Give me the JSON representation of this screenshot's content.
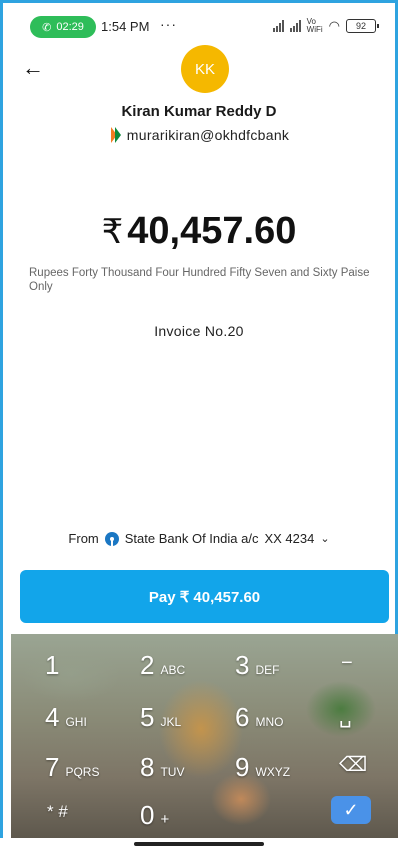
{
  "status_bar": {
    "call_time": "02:29",
    "time": "1:54 PM",
    "dots": "···",
    "battery": "92"
  },
  "payee": {
    "initials": "KK",
    "name": "Kiran Kumar Reddy D",
    "upi_id": "murarikiran@okhdfcbank"
  },
  "amount": {
    "currency_symbol": "₹",
    "value": "40,457.60",
    "in_words": "Rupees Forty Thousand Four Hundred Fifty Seven and Sixty Paise Only"
  },
  "note": "Invoice No.20",
  "from_account": {
    "label": "From",
    "bank": "State Bank Of India a/c",
    "account": "XX 4234"
  },
  "pay_button_label": "Pay ₹ 40,457.60",
  "keypad": {
    "keys": [
      {
        "digit": "1",
        "letters": ""
      },
      {
        "digit": "2",
        "letters": "ABC"
      },
      {
        "digit": "3",
        "letters": "DEF"
      },
      {
        "digit": "−",
        "letters": ""
      },
      {
        "digit": "4",
        "letters": "GHI"
      },
      {
        "digit": "5",
        "letters": "JKL"
      },
      {
        "digit": "6",
        "letters": "MNO"
      },
      {
        "digit": "␣",
        "letters": ""
      },
      {
        "digit": "7",
        "letters": "PQRS"
      },
      {
        "digit": "8",
        "letters": "TUV"
      },
      {
        "digit": "9",
        "letters": "WXYZ"
      },
      {
        "digit": "⌫",
        "letters": ""
      },
      {
        "digit": "* #",
        "letters": ""
      },
      {
        "digit": "0",
        "letters": "+"
      },
      {
        "digit": "",
        "letters": ""
      },
      {
        "digit": "✓",
        "letters": ""
      }
    ]
  },
  "colors": {
    "accent": "#12a5ea",
    "avatar": "#f5b800",
    "call_pill": "#2ebd59",
    "frame": "#2ea3e0"
  }
}
